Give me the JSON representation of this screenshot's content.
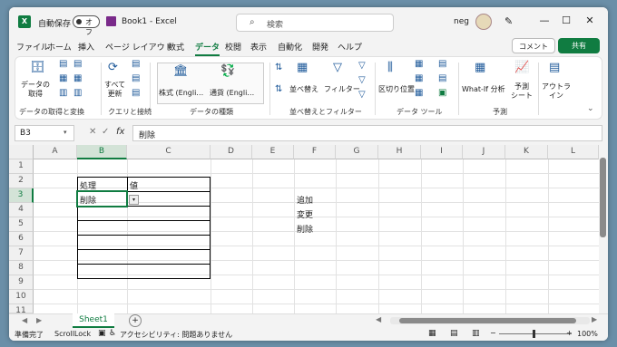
{
  "titlebar": {
    "app_icon": "excel-icon",
    "autosave_label": "自動保存",
    "autosave_state": "オフ",
    "document_title": "Book1  -  Excel",
    "search_placeholder": "検索",
    "user_name": "neg"
  },
  "menu": {
    "items": [
      "ファイル",
      "ホーム",
      "挿入",
      "ページ レイアウト",
      "数式",
      "データ",
      "校閲",
      "表示",
      "自動化",
      "開発",
      "ヘルプ"
    ],
    "active": "データ",
    "comment_label": "コメント",
    "share_label": "共有"
  },
  "ribbon": {
    "get_data": "データの\n取得",
    "refresh_all": "すべて\n更新",
    "stocks": "株式 (Engli…",
    "currencies": "通貨 (Engli…",
    "sort": "並べ替え",
    "filter": "フィルター",
    "text_to_columns": "区切り位置",
    "what_if": "What-If 分析",
    "forecast": "予測\nシート",
    "outline": "アウトラ\nイン",
    "groups": [
      "データの取得と変換",
      "クエリと接続",
      "データの種類",
      "並べ替えとフィルター",
      "データ ツール",
      "予測"
    ]
  },
  "formula_bar": {
    "name_box": "B3",
    "fx": "fx",
    "content": "削除"
  },
  "sheet": {
    "columns": [
      "A",
      "B",
      "C",
      "D",
      "E",
      "F",
      "G",
      "H",
      "I",
      "J",
      "K",
      "L"
    ],
    "selected_column": "B",
    "rows": [
      "1",
      "2",
      "3",
      "4",
      "5",
      "6",
      "7",
      "8",
      "9",
      "10",
      "11"
    ],
    "selected_row": "3",
    "cells": {
      "B2": "処理",
      "C2": "値",
      "B3": "削除",
      "F3": "追加",
      "F4": "変更",
      "F5": "削除"
    }
  },
  "tabs": {
    "sheet1": "Sheet1",
    "add": "+"
  },
  "status": {
    "ready": "準備完了",
    "scroll_lock": "ScrollLock",
    "accessibility": "アクセシビリティ: 問題ありません",
    "zoom": "100%"
  },
  "colors": {
    "accent": "#107c41"
  }
}
